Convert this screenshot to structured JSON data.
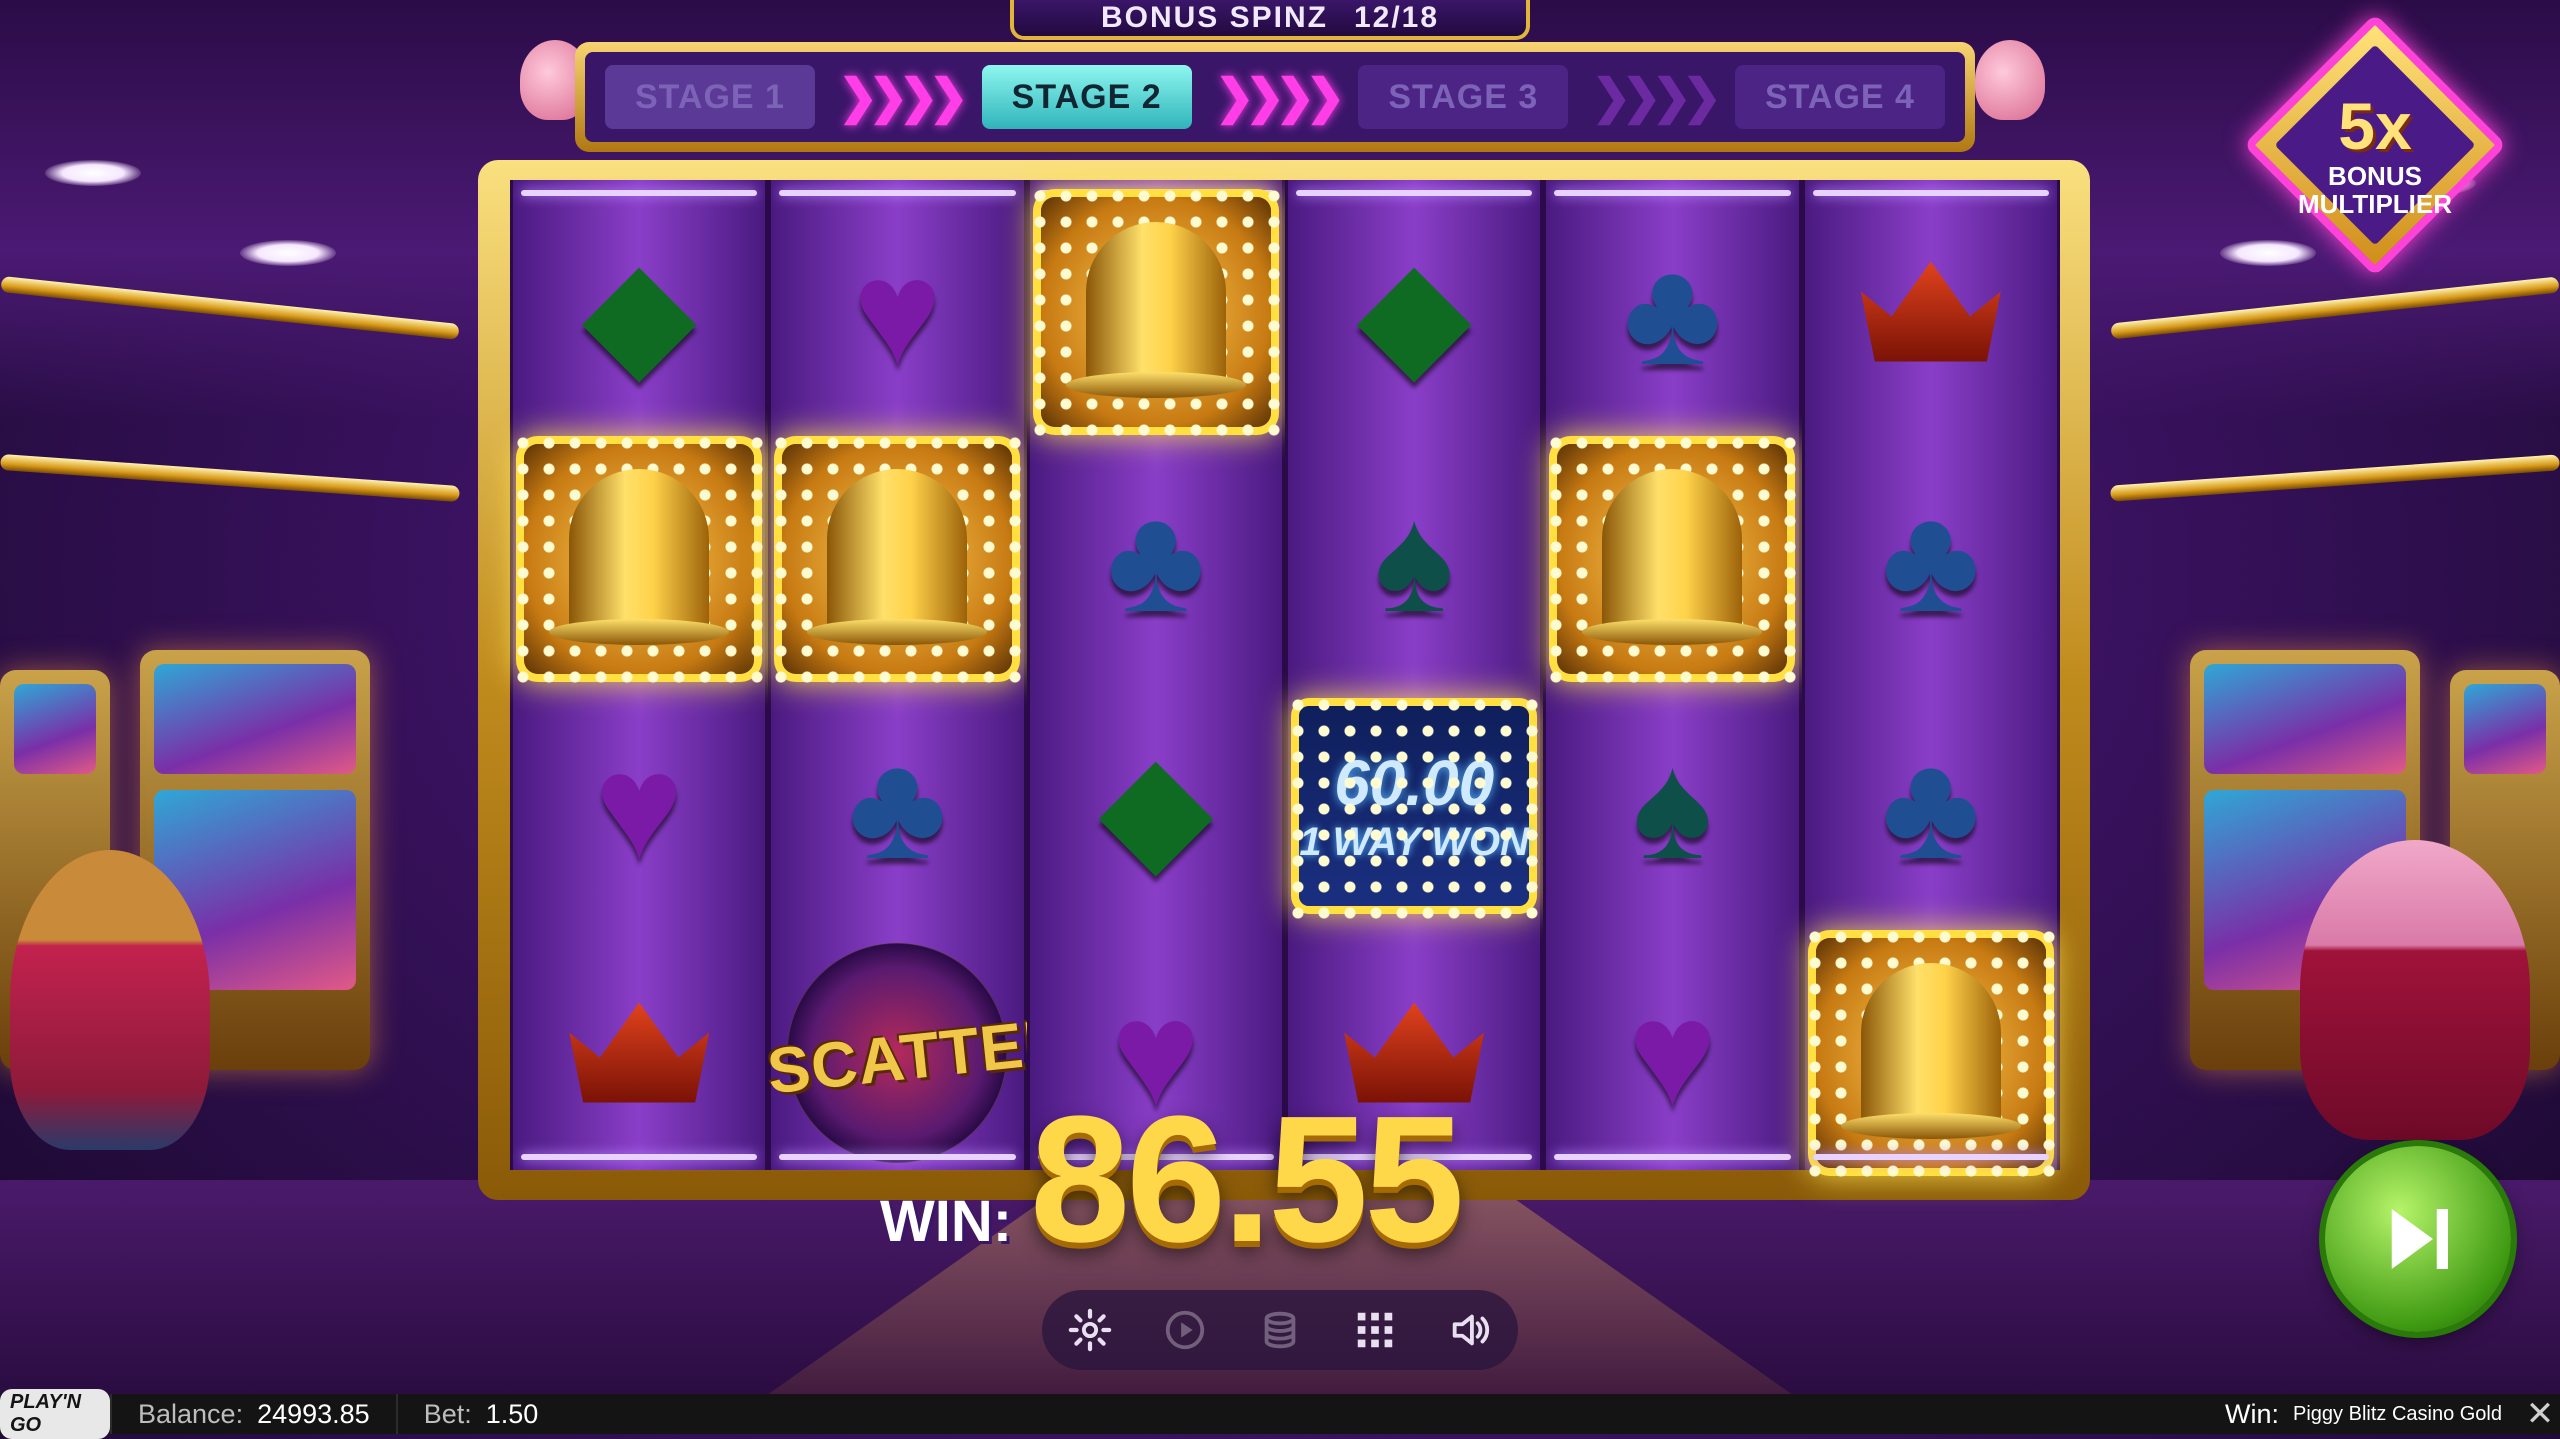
{
  "bonus": {
    "label": "BONUS SPINZ",
    "count": "12/18",
    "stages": [
      "STAGE 1",
      "STAGE 2",
      "STAGE 3",
      "STAGE 4"
    ],
    "active_stage_index": 1
  },
  "multiplier": {
    "value": "5x",
    "label_line1": "BONUS",
    "label_line2": "MULTIPLIER"
  },
  "reels": [
    [
      "diamond-green",
      "bell",
      "heart-purple",
      "crown-red"
    ],
    [
      "heart-purple",
      "bell",
      "club-blue",
      "scatter"
    ],
    [
      "bell",
      "club-blue",
      "diamond-green",
      "heart-purple"
    ],
    [
      "diamond-green",
      "spade-teal",
      "way-win",
      "crown-red"
    ],
    [
      "club-blue",
      "bell",
      "spade-teal",
      "heart-purple"
    ],
    [
      "crown-red",
      "club-blue",
      "club-blue",
      "bell"
    ]
  ],
  "scatter_label": "SCATTER",
  "way_win": {
    "amount": "60.00",
    "label": "1 WAY WON"
  },
  "win": {
    "label": "WIN:",
    "amount": "86.55"
  },
  "controls": [
    "settings-icon",
    "autoplay-icon",
    "bet-coins-icon",
    "menu-grid-icon",
    "sound-icon"
  ],
  "statusbar": {
    "logo_text": "PLAY'N GO",
    "balance_label": "Balance:",
    "balance_value": "24993.85",
    "bet_label": "Bet:",
    "bet_value": "1.50",
    "win_label": "Win:",
    "game_name": "Piggy Blitz Casino Gold"
  },
  "colors": {
    "accent_gold": "#ffd84a",
    "accent_pink": "#ff3ee8",
    "active_stage": "#2fb4ba",
    "skip_green": "#3f9a12"
  }
}
